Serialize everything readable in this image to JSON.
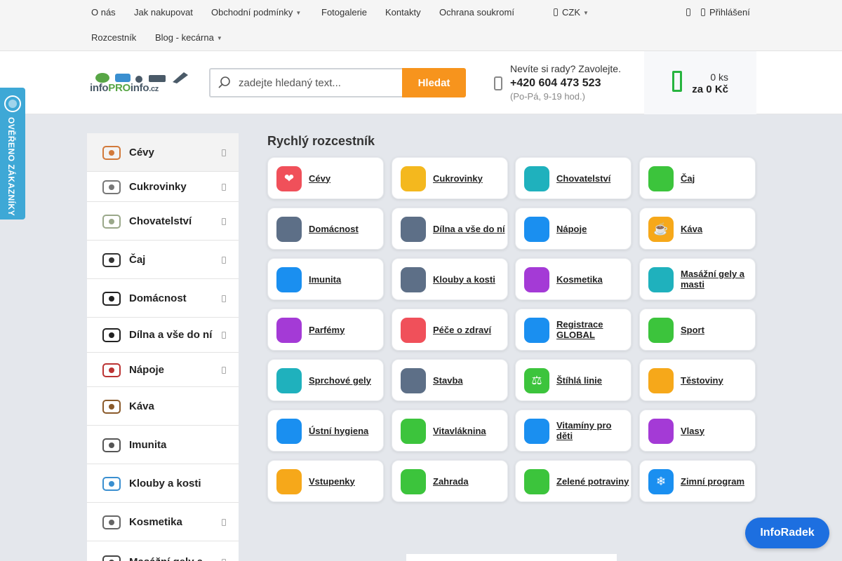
{
  "topnav": {
    "row1": [
      "O nás",
      "Jak nakupovat",
      "Obchodní podmínky",
      "Fotogalerie",
      "Kontakty",
      "Ochrana soukromí"
    ],
    "row2": [
      "Rozcestník",
      "Blog - kecárna"
    ],
    "currency": "CZK",
    "login": "Přihlášení"
  },
  "header": {
    "logo_text_a": "info",
    "logo_text_b": "PRO",
    "logo_text_c": "info",
    "logo_text_d": ".cz",
    "search_placeholder": "zadejte hledaný text...",
    "search_button": "Hledat",
    "contact_line1": "Nevíte si rady? Zavolejte.",
    "contact_phone": "+420 604 473 523",
    "contact_hours": "(Po-Pá, 9-19 hod.)",
    "cart_qty": "0 ks",
    "cart_price": "za 0 Kč"
  },
  "badge": {
    "text": "OVĚŘENO ZÁKAZNÍKY"
  },
  "sidebar": {
    "items": [
      {
        "label": "Cévy",
        "icon": "vessels-icon",
        "arrow": true
      },
      {
        "label": "Cukrovinky",
        "icon": "candy-icon",
        "arrow": true
      },
      {
        "label": "Chovatelství",
        "icon": "pet-bowl-icon",
        "arrow": true
      },
      {
        "label": "Čaj",
        "icon": "tea-cup-icon",
        "arrow": true
      },
      {
        "label": "Domácnost",
        "icon": "house-icon",
        "arrow": true
      },
      {
        "label": "Dílna a vše do ní",
        "icon": "tools-icon",
        "arrow": true
      },
      {
        "label": "Nápoje",
        "icon": "drinks-icon",
        "arrow": true
      },
      {
        "label": "Káva",
        "icon": "coffee-icon",
        "arrow": false
      },
      {
        "label": "Imunita",
        "icon": "immunity-icon",
        "arrow": false
      },
      {
        "label": "Klouby a kosti",
        "icon": "joints-icon",
        "arrow": false
      },
      {
        "label": "Kosmetika",
        "icon": "cosmetics-icon",
        "arrow": true
      },
      {
        "label": "Masážní gely a",
        "icon": "massage-icon",
        "arrow": true
      }
    ]
  },
  "main": {
    "title": "Rychlý rozcestník",
    "tiles": [
      {
        "label": "Cévy",
        "glyph": "❤",
        "color": "#f0505a",
        "icon": "heart-icon"
      },
      {
        "label": "Cukrovinky",
        "glyph": "",
        "color": "#f4b81e",
        "icon": "candy-icon"
      },
      {
        "label": "Chovatelství",
        "glyph": "",
        "color": "#1fb1bd",
        "icon": "paw-icon"
      },
      {
        "label": "Čaj",
        "glyph": "",
        "color": "#3cc43c",
        "icon": "leaf-icon"
      },
      {
        "label": "Domácnost",
        "glyph": "",
        "color": "#5d6f87",
        "icon": "house-icon"
      },
      {
        "label": "Dílna a vše do ní",
        "glyph": "",
        "color": "#5d6f87",
        "icon": "wrench-icon"
      },
      {
        "label": "Nápoje",
        "glyph": "",
        "color": "#1a8ff0",
        "icon": "glass-icon"
      },
      {
        "label": "Káva",
        "glyph": "☕",
        "color": "#f6a81a",
        "icon": "coffee-icon"
      },
      {
        "label": "Imunita",
        "glyph": "",
        "color": "#1a8ff0",
        "icon": "shield-icon"
      },
      {
        "label": "Klouby a kosti",
        "glyph": "",
        "color": "#5d6f87",
        "icon": "bone-icon"
      },
      {
        "label": "Kosmetika",
        "glyph": "",
        "color": "#a43ad6",
        "icon": "lipstick-icon"
      },
      {
        "label": "Masážní gely a masti",
        "glyph": "",
        "color": "#1fb1bd",
        "icon": "hand-icon"
      },
      {
        "label": "Parfémy",
        "glyph": "",
        "color": "#a43ad6",
        "icon": "perfume-icon"
      },
      {
        "label": "Péče o zdraví",
        "glyph": "",
        "color": "#f0505a",
        "icon": "medkit-icon"
      },
      {
        "label": "Registrace GLOBAL",
        "glyph": "",
        "color": "#1a8ff0",
        "icon": "user-icon"
      },
      {
        "label": "Sport",
        "glyph": "",
        "color": "#3cc43c",
        "icon": "ball-icon"
      },
      {
        "label": "Sprchové gely",
        "glyph": "",
        "color": "#1fb1bd",
        "icon": "shower-icon"
      },
      {
        "label": "Stavba",
        "glyph": "",
        "color": "#5d6f87",
        "icon": "brick-icon"
      },
      {
        "label": "Štíhlá linie",
        "glyph": "⚖",
        "color": "#3cc43c",
        "icon": "scale-icon"
      },
      {
        "label": "Těstoviny",
        "glyph": "",
        "color": "#f6a81a",
        "icon": "pasta-icon"
      },
      {
        "label": "Ústní hygiena",
        "glyph": "",
        "color": "#1a8ff0",
        "icon": "tooth-icon"
      },
      {
        "label": "Vitavláknina",
        "glyph": "",
        "color": "#3cc43c",
        "icon": "fiber-icon"
      },
      {
        "label": "Vitamíny pro děti",
        "glyph": "",
        "color": "#1a8ff0",
        "icon": "child-icon"
      },
      {
        "label": "Vlasy",
        "glyph": "",
        "color": "#a43ad6",
        "icon": "hair-icon"
      },
      {
        "label": "Vstupenky",
        "glyph": "",
        "color": "#f6a81a",
        "icon": "ticket-icon"
      },
      {
        "label": "Zahrada",
        "glyph": "",
        "color": "#3cc43c",
        "icon": "tree-icon"
      },
      {
        "label": "Zelené potraviny",
        "glyph": "",
        "color": "#3cc43c",
        "icon": "sprout-icon"
      },
      {
        "label": "Zimní program",
        "glyph": "❄",
        "color": "#1a8ff0",
        "icon": "snowflake-icon"
      }
    ]
  },
  "chat_button": "InfoRadek"
}
